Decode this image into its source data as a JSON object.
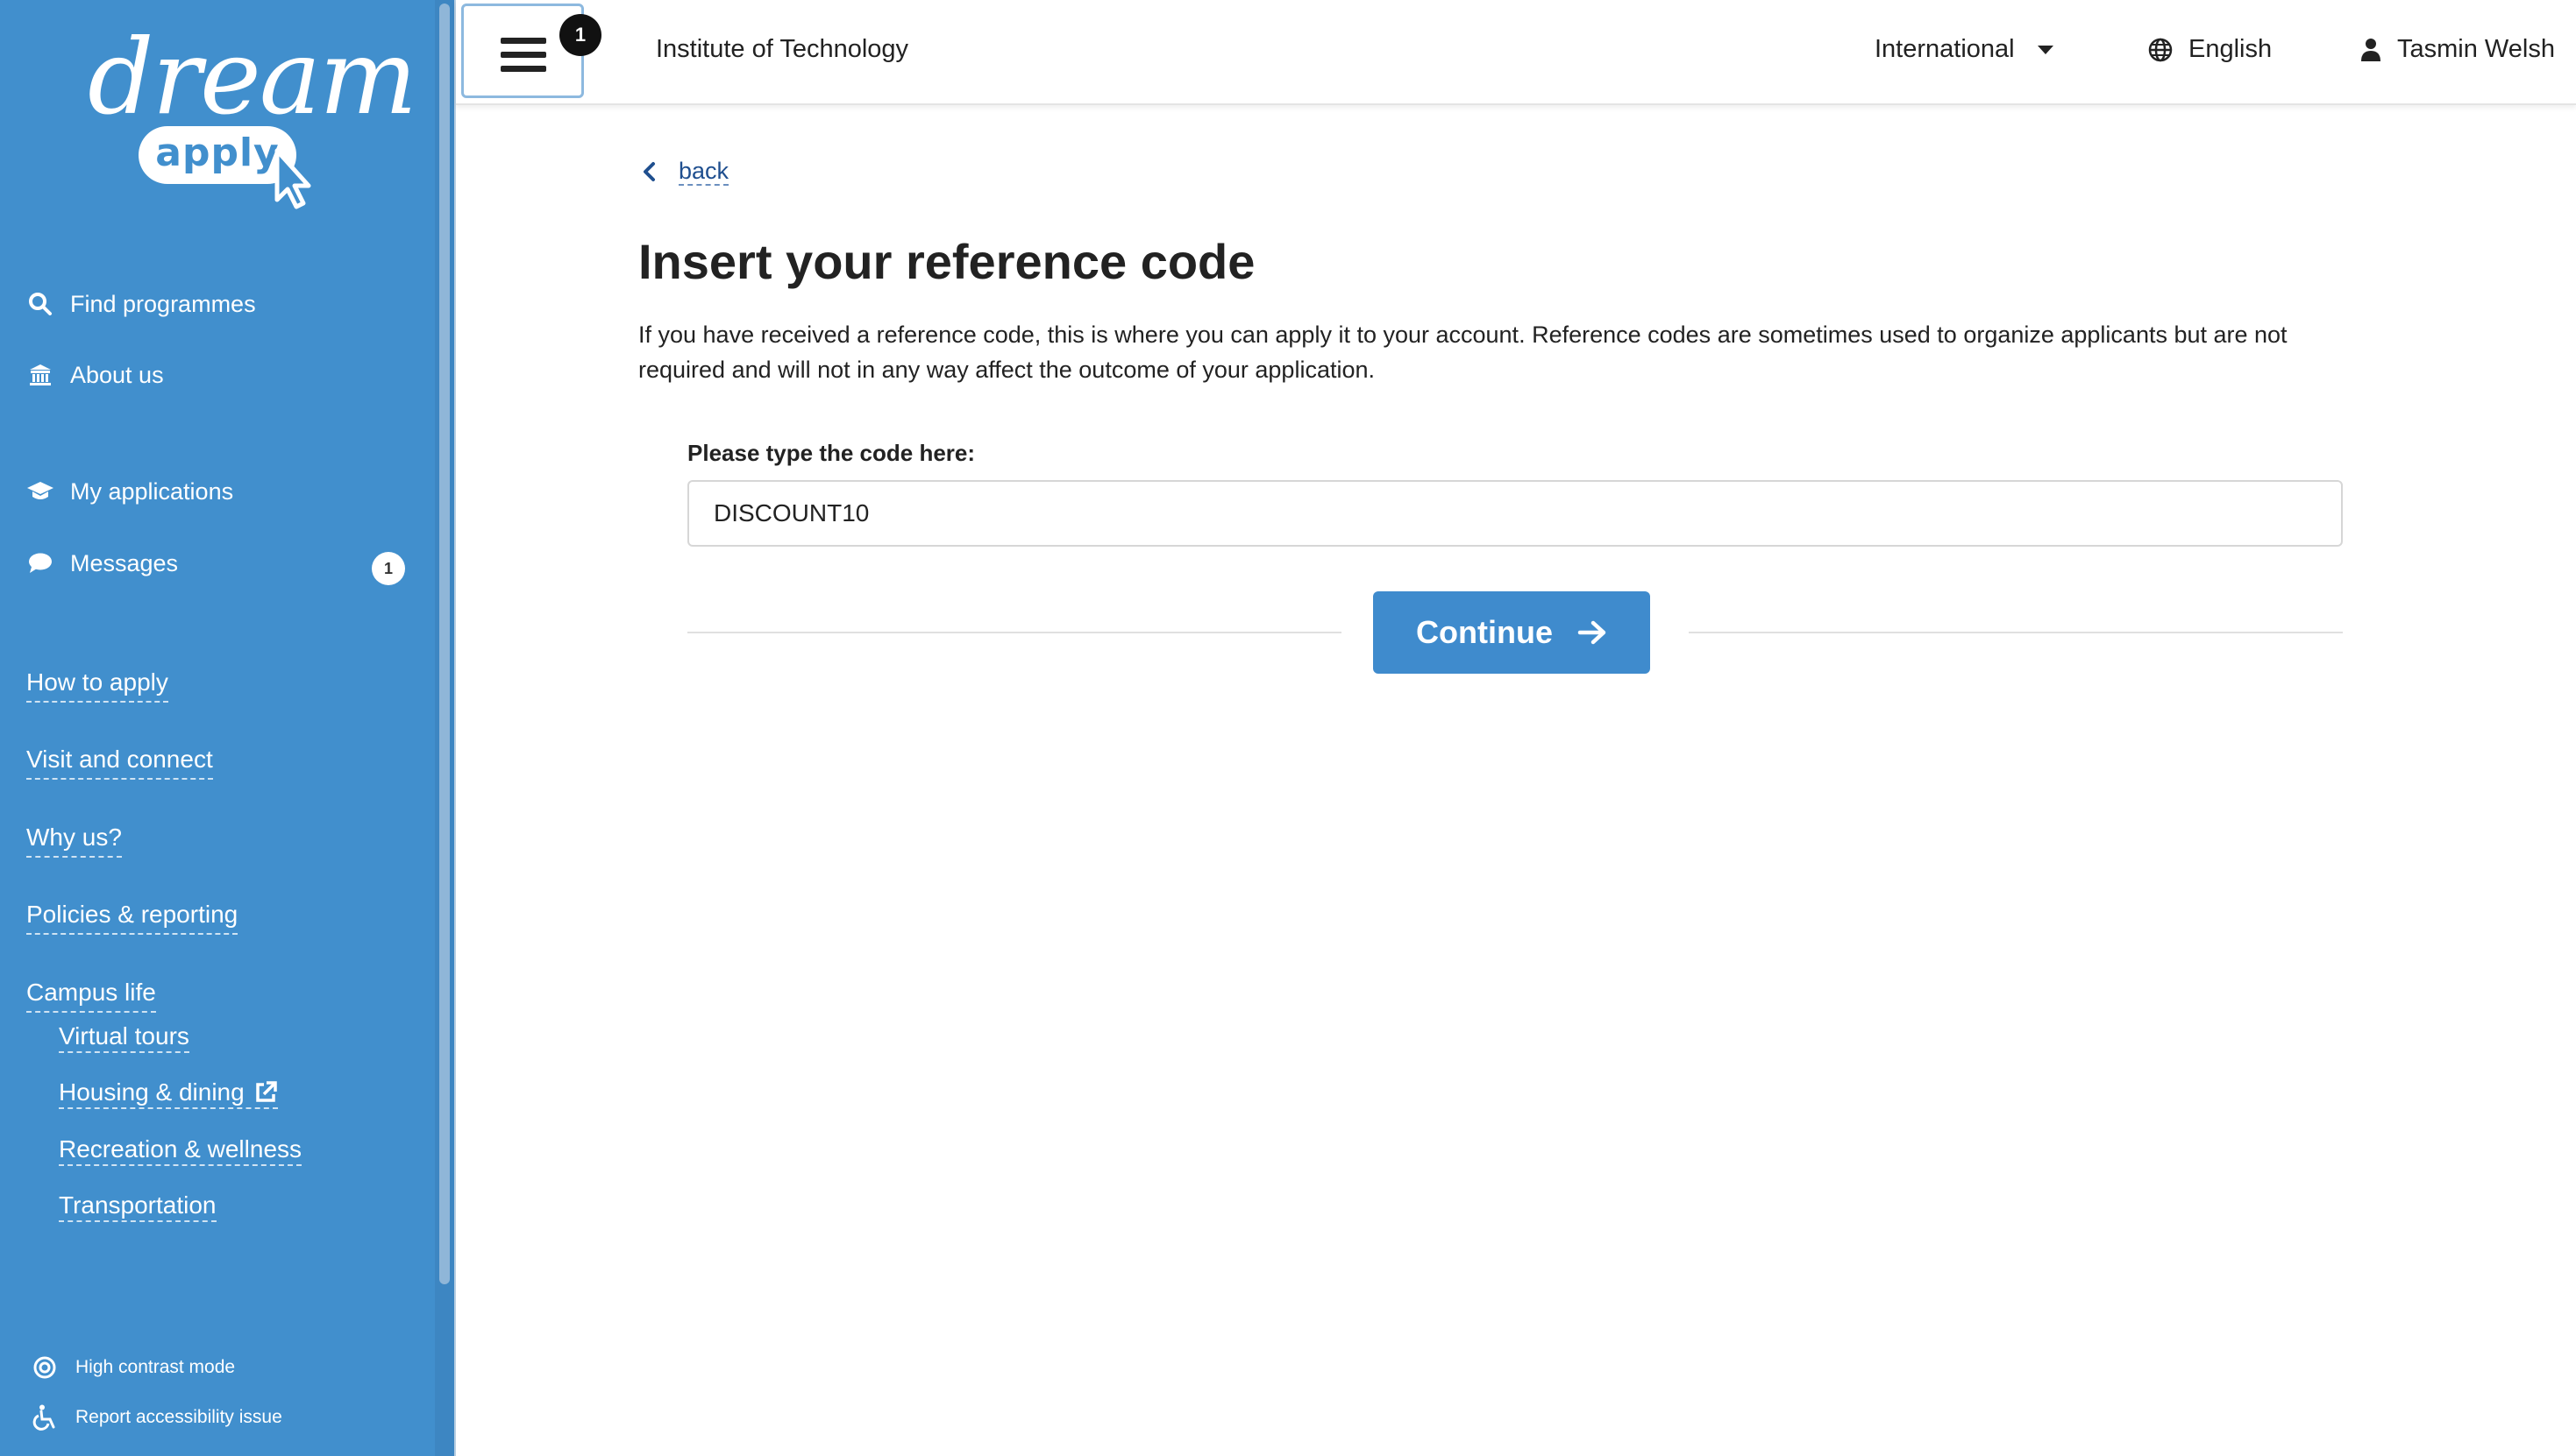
{
  "brand": {
    "logo_word": "dream",
    "logo_pill": "apply",
    "colors": {
      "sidebar": "#418fcd",
      "primary_button": "#3f8bcd",
      "link": "#1f4f8f"
    }
  },
  "sidebar": {
    "primary_nav": [
      {
        "label": "Find programmes",
        "icon": "search-icon"
      },
      {
        "label": "About us",
        "icon": "institution-icon"
      }
    ],
    "account_nav": [
      {
        "label": "My applications",
        "icon": "graduation-cap-icon"
      },
      {
        "label": "Messages",
        "icon": "chat-bubble-icon",
        "badge": "1"
      }
    ],
    "links": [
      "How to apply",
      "Visit and connect",
      "Why us?",
      "Policies & reporting",
      "Campus life"
    ],
    "sublinks": [
      {
        "label": "Virtual tours"
      },
      {
        "label": "Housing & dining",
        "icon": "external-link-icon"
      },
      {
        "label": "Recreation & wellness"
      },
      {
        "label": "Transportation"
      }
    ],
    "footer": [
      {
        "label": "High contrast mode",
        "icon": "contrast-icon"
      },
      {
        "label": "Report accessibility issue",
        "icon": "wheelchair-icon"
      }
    ]
  },
  "topbar": {
    "menu_badge": "1",
    "institution": "Institute of Technology",
    "region": "International",
    "language": "English",
    "user": "Tasmin Welsh"
  },
  "main": {
    "back_label": "back",
    "title": "Insert your reference code",
    "intro": "If you have received a reference code, this is where you can apply it to your account. Reference codes are sometimes used to organize applicants but are not required and will not in any way affect the outcome of your application.",
    "field_label": "Please type the code here:",
    "code_value": "DISCOUNT10",
    "continue_label": "Continue"
  }
}
